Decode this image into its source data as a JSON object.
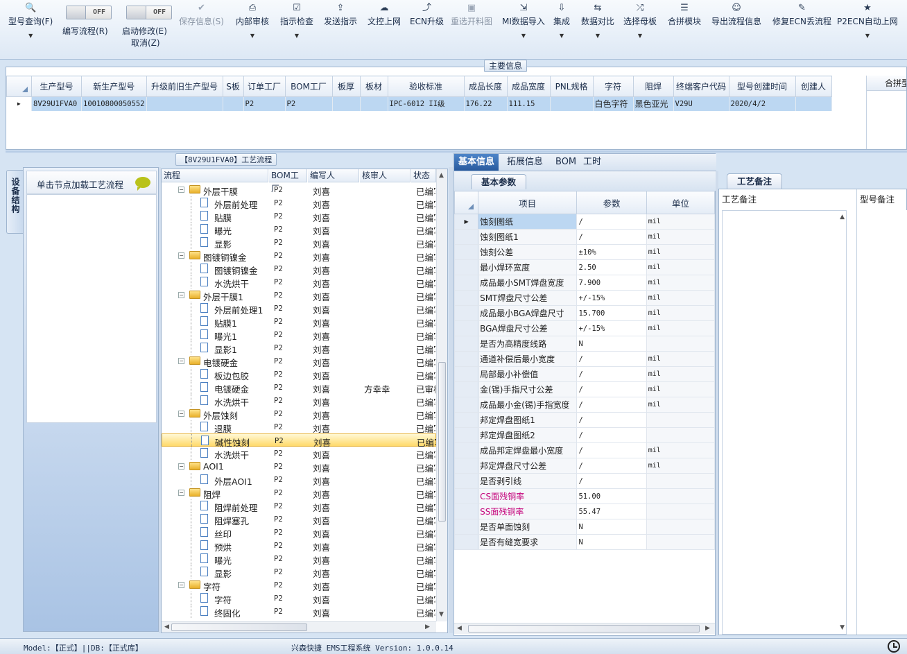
{
  "toolbar": {
    "buttons": [
      {
        "label": "型号查询(F)",
        "icon": "search-icon",
        "dropdown": true
      },
      {
        "label": "保存信息(S)",
        "icon": "check-icon",
        "disabled": true
      },
      {
        "label": "内部审核",
        "icon": "printer-icon",
        "dropdown": true
      },
      {
        "label": "指示检查",
        "icon": "checkbox-icon",
        "dropdown": true
      },
      {
        "label": "发送指示",
        "icon": "upload-icon"
      },
      {
        "label": "文控上网",
        "icon": "cloud-upload-icon"
      },
      {
        "label": "ECN升级",
        "icon": "ecn-upgrade-icon"
      },
      {
        "label": "重选开料图",
        "icon": "image-icon",
        "disabled": true
      },
      {
        "label": "MI数据导入",
        "icon": "import-icon",
        "dropdown": true
      },
      {
        "label": "集成",
        "icon": "download-icon",
        "dropdown": true
      },
      {
        "label": "数据对比",
        "icon": "compare-icon",
        "dropdown": true
      },
      {
        "label": "选择母板",
        "icon": "shuffle-icon",
        "dropdown": true
      },
      {
        "label": "合拼模块",
        "icon": "list-icon"
      },
      {
        "label": "导出流程信息",
        "icon": "smiley-icon"
      },
      {
        "label": "修复ECN丢流程",
        "icon": "wrench-icon"
      },
      {
        "label": "P2ECN自动上网",
        "icon": "star-icon",
        "dropdown": true
      }
    ],
    "toggles": [
      {
        "state": "OFF",
        "label": "编写流程(R)"
      },
      {
        "state": "OFF",
        "label": "启动修改(E)",
        "label2": "取消(Z)"
      }
    ]
  },
  "main_info": {
    "title": "主要信息",
    "columns": [
      "生产型号",
      "新生产型号",
      "升级前旧生产型号",
      "S板",
      "订单工厂",
      "BOM工厂",
      "板厚",
      "板材",
      "验收标准",
      "成品长度",
      "成品宽度",
      "PNL规格",
      "字符",
      "阻焊",
      "终端客户代码",
      "型号创建时间",
      "创建人"
    ],
    "right_header": "合拼型",
    "rows": [
      [
        "8V29U1FVA0",
        "10010800050552",
        "",
        "",
        "P2",
        "P2",
        "",
        "",
        "IPC-6012 II级",
        "176.22",
        "111.15",
        "",
        "白色字符",
        "黑色亚光",
        "V29U",
        "2020/4/2",
        ""
      ]
    ]
  },
  "left": {
    "vertical_tab": "设备结构",
    "load_text": "单击节点加载工艺流程"
  },
  "tree": {
    "title": "【8V29U1FVA0】工艺流程",
    "columns": [
      "流程",
      "BOM工厂",
      "编写人",
      "核审人",
      "状态"
    ],
    "rows": [
      {
        "name": "外层干膜",
        "type": "folder",
        "bom": "P2",
        "writer": "刘喜",
        "reviewer": "",
        "status": "已编写"
      },
      {
        "name": "外层前处理",
        "type": "doc",
        "bom": "P2",
        "writer": "刘喜",
        "reviewer": "",
        "status": "已编写"
      },
      {
        "name": "贴膜",
        "type": "doc",
        "bom": "P2",
        "writer": "刘喜",
        "reviewer": "",
        "status": "已编写"
      },
      {
        "name": "曝光",
        "type": "doc",
        "bom": "P2",
        "writer": "刘喜",
        "reviewer": "",
        "status": "已编写"
      },
      {
        "name": "显影",
        "type": "doc",
        "bom": "P2",
        "writer": "刘喜",
        "reviewer": "",
        "status": "已编写"
      },
      {
        "name": "图镀铜镍金",
        "type": "folder",
        "bom": "P2",
        "writer": "刘喜",
        "reviewer": "",
        "status": "已编写"
      },
      {
        "name": "图镀铜镍金",
        "type": "doc",
        "bom": "P2",
        "writer": "刘喜",
        "reviewer": "",
        "status": "已编写"
      },
      {
        "name": "水洗烘干",
        "type": "doc",
        "bom": "P2",
        "writer": "刘喜",
        "reviewer": "",
        "status": "已编写"
      },
      {
        "name": "外层干膜1",
        "type": "folder",
        "bom": "P2",
        "writer": "刘喜",
        "reviewer": "",
        "status": "已编写"
      },
      {
        "name": "外层前处理1",
        "type": "doc",
        "bom": "P2",
        "writer": "刘喜",
        "reviewer": "",
        "status": "已编写"
      },
      {
        "name": "贴膜1",
        "type": "doc",
        "bom": "P2",
        "writer": "刘喜",
        "reviewer": "",
        "status": "已编写"
      },
      {
        "name": "曝光1",
        "type": "doc",
        "bom": "P2",
        "writer": "刘喜",
        "reviewer": "",
        "status": "已编写"
      },
      {
        "name": "显影1",
        "type": "doc",
        "bom": "P2",
        "writer": "刘喜",
        "reviewer": "",
        "status": "已编写"
      },
      {
        "name": "电镀硬金",
        "type": "folder",
        "bom": "P2",
        "writer": "刘喜",
        "reviewer": "",
        "status": "已编写"
      },
      {
        "name": "板边包胶",
        "type": "doc",
        "bom": "P2",
        "writer": "刘喜",
        "reviewer": "",
        "status": "已编写"
      },
      {
        "name": "电镀硬金",
        "type": "doc",
        "bom": "P2",
        "writer": "刘喜",
        "reviewer": "方幸幸",
        "status": "已审核"
      },
      {
        "name": "水洗烘干",
        "type": "doc",
        "bom": "P2",
        "writer": "刘喜",
        "reviewer": "",
        "status": "已编写"
      },
      {
        "name": "外层蚀刻",
        "type": "folder",
        "bom": "P2",
        "writer": "刘喜",
        "reviewer": "",
        "status": "已编写"
      },
      {
        "name": "退膜",
        "type": "doc",
        "bom": "P2",
        "writer": "刘喜",
        "reviewer": "",
        "status": "已编写"
      },
      {
        "name": "碱性蚀刻",
        "type": "doc",
        "bom": "P2",
        "writer": "刘喜",
        "reviewer": "",
        "status": "已编写",
        "selected": true
      },
      {
        "name": "水洗烘干",
        "type": "doc",
        "bom": "P2",
        "writer": "刘喜",
        "reviewer": "",
        "status": "已编写"
      },
      {
        "name": "AOI1",
        "type": "folder",
        "bom": "P2",
        "writer": "刘喜",
        "reviewer": "",
        "status": "已编写"
      },
      {
        "name": "外层AOI1",
        "type": "doc",
        "bom": "P2",
        "writer": "刘喜",
        "reviewer": "",
        "status": "已编写"
      },
      {
        "name": "阻焊",
        "type": "folder",
        "bom": "P2",
        "writer": "刘喜",
        "reviewer": "",
        "status": "已编写"
      },
      {
        "name": "阻焊前处理",
        "type": "doc",
        "bom": "P2",
        "writer": "刘喜",
        "reviewer": "",
        "status": "已编写"
      },
      {
        "name": "阻焊塞孔",
        "type": "doc",
        "bom": "P2",
        "writer": "刘喜",
        "reviewer": "",
        "status": "已编写"
      },
      {
        "name": "丝印",
        "type": "doc",
        "bom": "P2",
        "writer": "刘喜",
        "reviewer": "",
        "status": "已编写"
      },
      {
        "name": "预烘",
        "type": "doc",
        "bom": "P2",
        "writer": "刘喜",
        "reviewer": "",
        "status": "已编写"
      },
      {
        "name": "曝光",
        "type": "doc",
        "bom": "P2",
        "writer": "刘喜",
        "reviewer": "",
        "status": "已编写"
      },
      {
        "name": "显影",
        "type": "doc",
        "bom": "P2",
        "writer": "刘喜",
        "reviewer": "",
        "status": "已编写"
      },
      {
        "name": "字符",
        "type": "folder",
        "bom": "P2",
        "writer": "刘喜",
        "reviewer": "",
        "status": "已编写"
      },
      {
        "name": "字符",
        "type": "doc",
        "bom": "P2",
        "writer": "刘喜",
        "reviewer": "",
        "status": "已编写"
      },
      {
        "name": "终固化",
        "type": "doc",
        "bom": "P2",
        "writer": "刘喜",
        "reviewer": "",
        "status": "已编写"
      }
    ]
  },
  "detail": {
    "tabs": [
      "基本信息",
      "拓展信息",
      "BOM",
      "工时"
    ],
    "sub_tab": "基本参数",
    "columns": [
      "项目",
      "参数",
      "单位"
    ],
    "rows": [
      {
        "item": "蚀刻图纸",
        "value": "/",
        "unit": "mil",
        "selected": true
      },
      {
        "item": "蚀刻图纸1",
        "value": "/",
        "unit": "mil"
      },
      {
        "item": "蚀刻公差",
        "value": "±10%",
        "unit": "mil"
      },
      {
        "item": "最小焊环宽度",
        "value": "2.50",
        "unit": "mil"
      },
      {
        "item": "成品最小SMT焊盘宽度",
        "value": "7.900",
        "unit": "mil"
      },
      {
        "item": "SMT焊盘尺寸公差",
        "value": "+/-15%",
        "unit": "mil"
      },
      {
        "item": "成品最小BGA焊盘尺寸",
        "value": "15.700",
        "unit": "mil"
      },
      {
        "item": "BGA焊盘尺寸公差",
        "value": "+/-15%",
        "unit": "mil"
      },
      {
        "item": "是否为高精度线路",
        "value": "N",
        "unit": ""
      },
      {
        "item": "通道补偿后最小宽度",
        "value": "/",
        "unit": "mil"
      },
      {
        "item": "局部最小补偿值",
        "value": "/",
        "unit": "mil"
      },
      {
        "item": "金(锡)手指尺寸公差",
        "value": "/",
        "unit": "mil"
      },
      {
        "item": "成品最小金(锡)手指宽度",
        "value": "/",
        "unit": "mil"
      },
      {
        "item": "邦定焊盘图纸1",
        "value": "/",
        "unit": ""
      },
      {
        "item": "邦定焊盘图纸2",
        "value": "/",
        "unit": ""
      },
      {
        "item": "成品邦定焊盘最小宽度",
        "value": "/",
        "unit": "mil"
      },
      {
        "item": "邦定焊盘尺寸公差",
        "value": "/",
        "unit": "mil"
      },
      {
        "item": "是否剥引线",
        "value": "/",
        "unit": ""
      },
      {
        "item": "CS面残铜率",
        "value": "51.00",
        "unit": "",
        "highlight": "#c4007a"
      },
      {
        "item": "SS面残铜率",
        "value": "55.47",
        "unit": "",
        "highlight": "#c4007a"
      },
      {
        "item": "是否单面蚀刻",
        "value": "N",
        "unit": ""
      },
      {
        "item": "是否有缝宽要求",
        "value": "N",
        "unit": ""
      }
    ]
  },
  "remark": {
    "tab": "工艺备注",
    "col1": "工艺备注",
    "col2": "型号备注"
  },
  "status_bar": {
    "left": "Model:【正式】||DB:【正式库】",
    "center": "兴森快捷 EMS工程系统 Version: 1.0.0.14"
  },
  "colors": {
    "accent": "#285a9e",
    "selected_row": "#bcd7f2",
    "tree_selected": "#ffd96a",
    "pink_text": "#c4007a"
  }
}
